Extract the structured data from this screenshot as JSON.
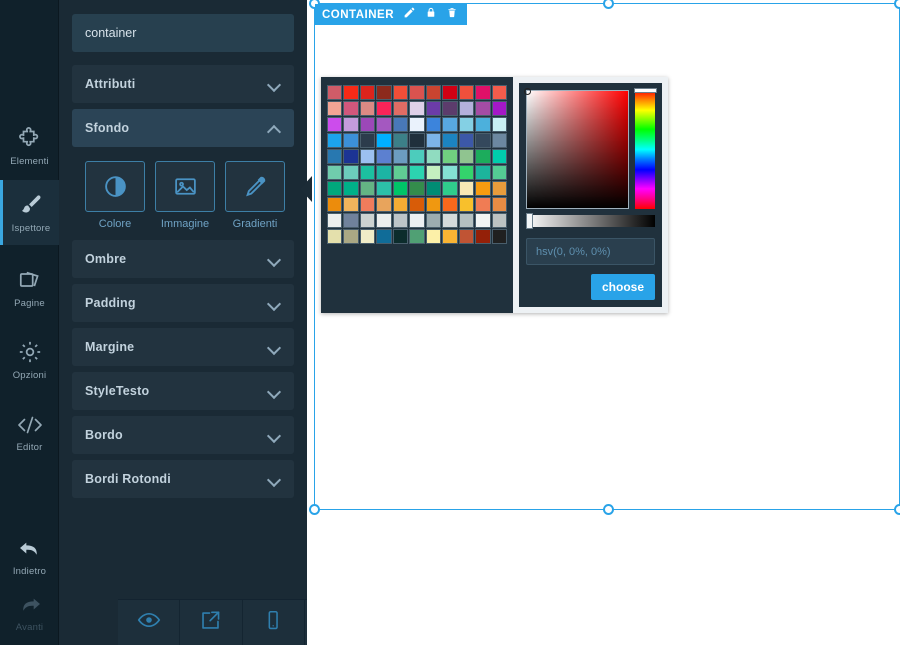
{
  "rail": {
    "items": [
      {
        "label": "Elementi",
        "icon": "puzzle-icon",
        "state": "normal"
      },
      {
        "label": "Ispettore",
        "icon": "brush-icon",
        "state": "active"
      },
      {
        "label": "Pagine",
        "icon": "pages-icon",
        "state": "normal"
      },
      {
        "label": "Opzioni",
        "icon": "gear-icon",
        "state": "normal"
      },
      {
        "label": "Editor",
        "icon": "code-icon",
        "state": "normal"
      },
      {
        "label": "Indietro",
        "icon": "undo-arrow-icon",
        "state": "normal"
      },
      {
        "label": "Avanti",
        "icon": "redo-arrow-icon",
        "state": "disabled"
      }
    ]
  },
  "panel": {
    "name_field": {
      "value": "container",
      "placeholder": "container"
    },
    "sections": [
      {
        "title": "Attributi",
        "open": false
      },
      {
        "title": "Sfondo",
        "open": true
      },
      {
        "title": "Ombre",
        "open": false
      },
      {
        "title": "Padding",
        "open": false
      },
      {
        "title": "Margine",
        "open": false
      },
      {
        "title": "StyleTesto",
        "open": false
      },
      {
        "title": "Bordo",
        "open": false
      },
      {
        "title": "Bordi Rotondi",
        "open": false
      }
    ],
    "background_types": [
      {
        "label": "Colore",
        "icon": "contrast-circle-icon"
      },
      {
        "label": "Immagine",
        "icon": "image-icon"
      },
      {
        "label": "Gradienti",
        "icon": "eyedropper-icon"
      }
    ]
  },
  "toolbar": {
    "buttons": [
      {
        "name": "preview",
        "icon": "eye-icon"
      },
      {
        "name": "export",
        "icon": "share-export-icon"
      },
      {
        "name": "device",
        "icon": "mobile-icon"
      },
      {
        "name": "save",
        "icon": "floppy-save-icon"
      }
    ]
  },
  "canvas": {
    "selection_tag": {
      "label": "CONTAINER",
      "actions": [
        {
          "name": "edit",
          "icon": "pencil-icon"
        },
        {
          "name": "lock",
          "icon": "lock-icon"
        },
        {
          "name": "delete",
          "icon": "trash-icon"
        }
      ]
    }
  },
  "color_picker": {
    "hsv_value": "hsv(0, 0%, 0%)",
    "choose_label": "choose",
    "swatches": [
      [
        "#cf5c68",
        "#f62a17",
        "#dc241c",
        "#8c2a1c",
        "#f04e38",
        "#d9534f",
        "#c94430",
        "#d00014",
        "#ef503c",
        "#e01068",
        "#f45c4c"
      ],
      [
        "#f3a494",
        "#d1577c",
        "#dc8a84",
        "#fa2458",
        "#e06c64",
        "#ded0e8",
        "#6c3ca8",
        "#5c3c6c",
        "#b4b0dc",
        "#a44ca4",
        "#a418c8"
      ],
      [
        "#cc4cec",
        "#c49cdc",
        "#9c48b8",
        "#a458c0",
        "#4878b8",
        "#eaf2fc",
        "#3c84dc",
        "#58a8e0",
        "#84d0e4",
        "#4cb0dc",
        "#c8f0f4"
      ],
      [
        "#1ca4ec",
        "#3c90d8",
        "#2c3c4c",
        "#00b0ff",
        "#3c8088",
        "#20303c",
        "#7cb4e8",
        "#1c84c0",
        "#3c58a8",
        "#34485c",
        "#6c88a0"
      ],
      [
        "#2878b0",
        "#1c3494",
        "#9cc0f0",
        "#5c80d0",
        "#6c9cc0",
        "#4cccbc",
        "#90dcc0",
        "#70d080",
        "#90c490",
        "#1cac5c",
        "#00ccac"
      ],
      [
        "#70ccac",
        "#6cccbc",
        "#1cc0a0",
        "#1cb4a4",
        "#60cc94",
        "#2cd4b0",
        "#c4f0c0",
        "#84e0d4",
        "#34d46c",
        "#1cb49c",
        "#54cc94"
      ],
      [
        "#00a87c",
        "#00b088",
        "#64b484",
        "#2cc0a8",
        "#00c468",
        "#348c4c",
        "#008c74",
        "#30cc8c",
        "#f8e8b4",
        "#f89c10",
        "#e89c3c"
      ],
      [
        "#ec8c0c",
        "#f0b45c",
        "#f07c5c",
        "#e8a45c",
        "#f4ac34",
        "#d85c08",
        "#f09810",
        "#f8681c",
        "#f8c02c",
        "#f07c54",
        "#e88c44"
      ],
      [
        "#eceeed",
        "#70829c",
        "#ccd2d0",
        "#eceeec",
        "#bcc4c8",
        "#eceff2",
        "#9cacb0",
        "#d4dadc",
        "#b4c0c0",
        "#f2f5f4",
        "#bcc2c2"
      ],
      [
        "#e4e0ac",
        "#aaa884",
        "#f0ecc8",
        "#106c98",
        "#0c2c2c",
        "#50a074",
        "#fcf0a8",
        "#f8b434",
        "#c05434",
        "#942008",
        "#202020"
      ]
    ]
  }
}
